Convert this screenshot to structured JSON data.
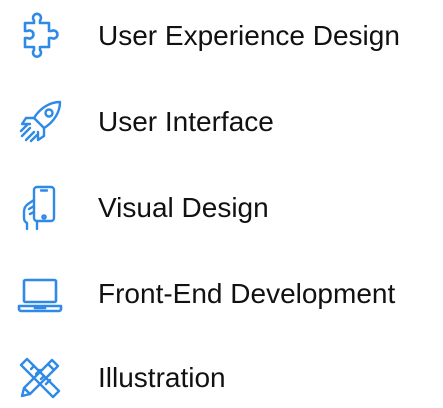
{
  "accent_color": "#2e8ae6",
  "skills": {
    "items": [
      {
        "label": "User Experience Design",
        "icon": "puzzle-piece-icon"
      },
      {
        "label": "User Interface",
        "icon": "rocket-icon"
      },
      {
        "label": "Visual Design",
        "icon": "hand-holding-phone-icon"
      },
      {
        "label": "Front-End Development",
        "icon": "laptop-icon"
      },
      {
        "label": "Illustration",
        "icon": "pencil-ruler-icon"
      }
    ]
  }
}
